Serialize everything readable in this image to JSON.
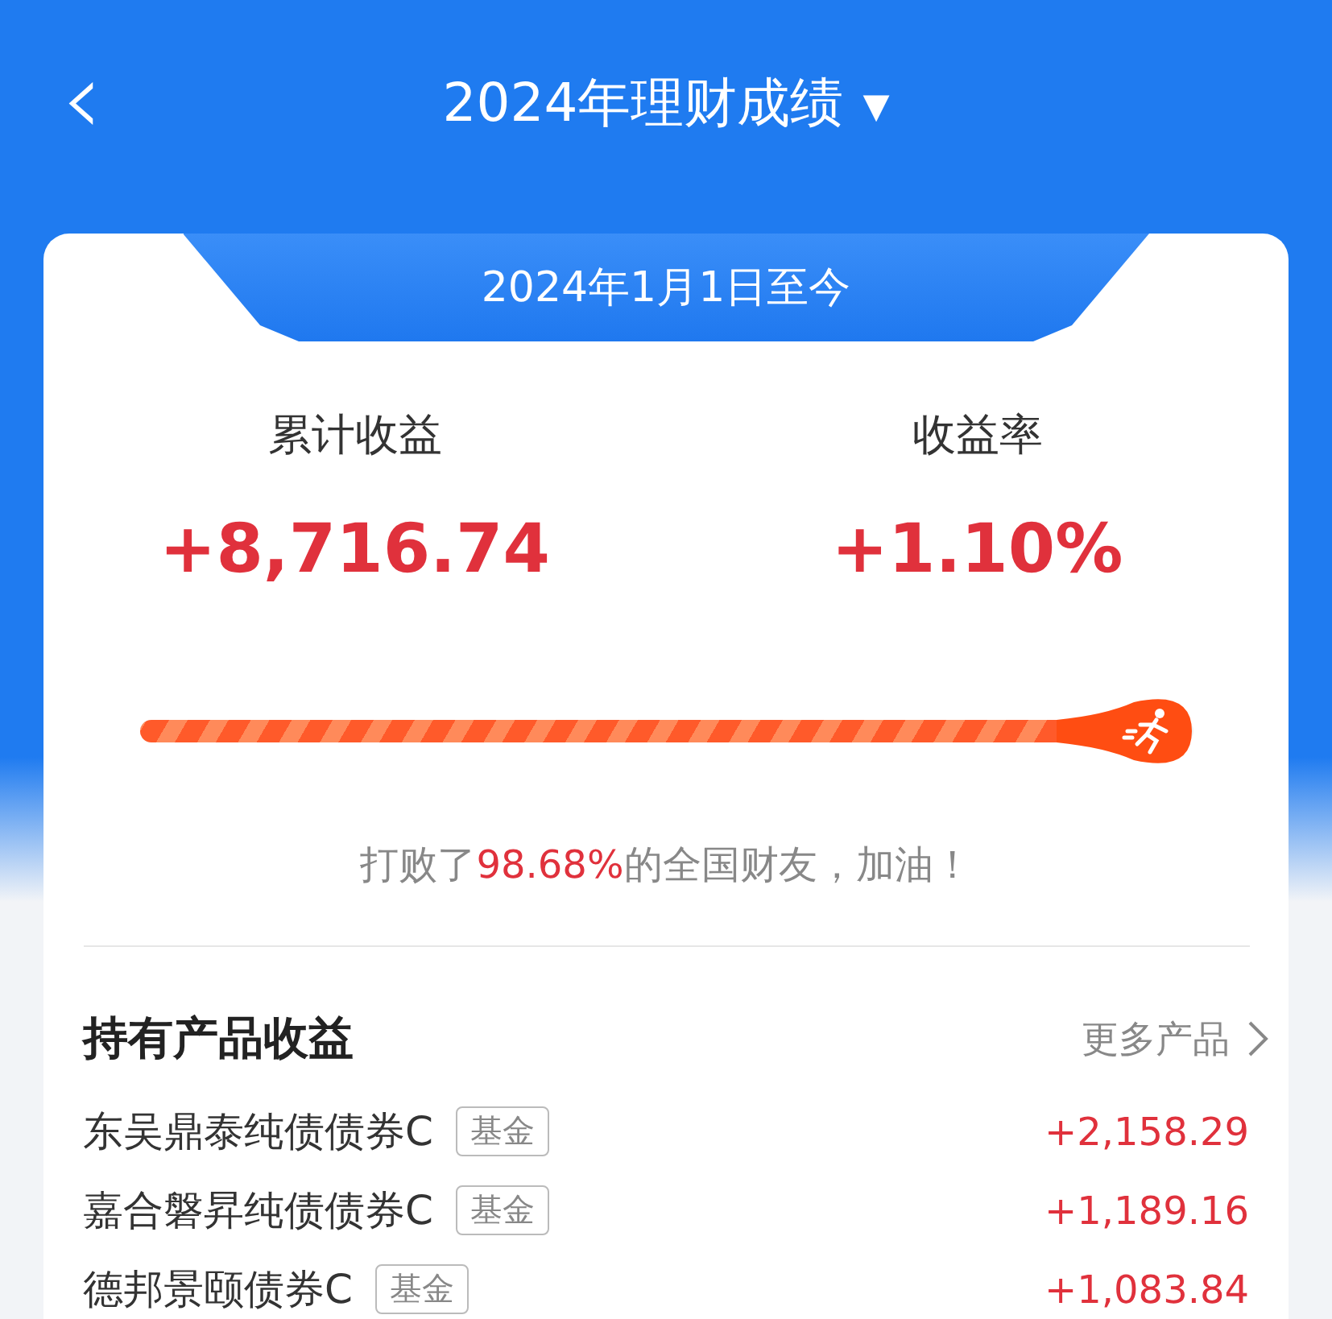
{
  "header": {
    "back": "‹",
    "title": "2024年理财成绩",
    "dropdown": "▾"
  },
  "period": "2024年1月1日至今",
  "metrics": [
    {
      "label": "累计收益",
      "value": "+8,716.74"
    },
    {
      "label": "收益率",
      "value": "+1.10%"
    }
  ],
  "ranking": {
    "level": 0.9868,
    "before": "打败了",
    "highlight": "98.68%",
    "after": "的全国财友，加油！"
  },
  "holdings": {
    "title": "持有产品收益",
    "more": "更多产品",
    "rows": [
      {
        "name": "东吴鼎泰纯债债券C",
        "tag": "基金",
        "value": "+2,158.29"
      },
      {
        "name": "嘉合磐昇纯债债券C",
        "tag": "基金",
        "value": "+1,189.16"
      },
      {
        "name": "德邦景颐债券C",
        "tag": "基金",
        "value": "+1,083.84"
      }
    ]
  }
}
